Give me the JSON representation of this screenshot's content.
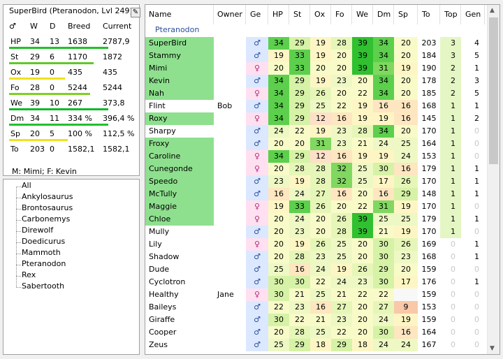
{
  "stats_panel": {
    "title": "SuperBird (Pteranodon, Lvl 249)",
    "edit_icon": "pencil-icon",
    "headers": [
      "W",
      "D",
      "Breed",
      "Current"
    ],
    "gender_symbol": "♂",
    "rows": [
      {
        "stat": "HP",
        "w": "34",
        "d": "13",
        "breed": "1638",
        "current": "2787,9",
        "bar_color": "#22c02a",
        "bar_fraction": 1.0
      },
      {
        "stat": "St",
        "w": "29",
        "d": "6",
        "breed": "1170",
        "current": "1872",
        "bar_color": "#60c828",
        "bar_fraction": 0.85
      },
      {
        "stat": "Ox",
        "w": "19",
        "d": "0",
        "breed": "435",
        "current": "435",
        "bar_color": "#f0e020",
        "bar_fraction": 0.56
      },
      {
        "stat": "Fo",
        "w": "28",
        "d": "0",
        "breed": "5244",
        "current": "5244",
        "bar_color": "#80d020",
        "bar_fraction": 0.82
      },
      {
        "stat": "We",
        "w": "39",
        "d": "10",
        "breed": "267",
        "current": "373,8",
        "bar_color": "#10b828",
        "bar_fraction": 1.0
      },
      {
        "stat": "Dm",
        "w": "34",
        "d": "11",
        "breed": "334 %",
        "current": "396,4 %",
        "bar_color": "#22c02a",
        "bar_fraction": 1.0
      },
      {
        "stat": "Sp",
        "w": "20",
        "d": "5",
        "breed": "100 %",
        "current": "112,5 %",
        "bar_color": "#f0e020",
        "bar_fraction": 0.59
      },
      {
        "stat": "To",
        "w": "203",
        "d": "0",
        "breed": "1582,1",
        "current": "1582,1",
        "bar_color": "",
        "bar_fraction": 0
      }
    ],
    "parents": "M: Mimi; F: Kevin"
  },
  "species_tree": [
    "All",
    "Ankylosaurus",
    "Brontosaurus",
    "Carbonemys",
    "Direwolf",
    "Doedicurus",
    "Mammoth",
    "Pteranodon",
    "Rex",
    "Sabertooth"
  ],
  "grid": {
    "columns": [
      "Name",
      "Owner",
      "Ge",
      "HP",
      "St",
      "Ox",
      "Fo",
      "We",
      "Dm",
      "Sp",
      "To",
      "Top",
      "Gen"
    ],
    "group_label": "Pteranodon",
    "rows": [
      {
        "name": "SuperBird",
        "owner": "",
        "g": "♂",
        "hp": "34",
        "st": "29",
        "ox": "19",
        "fo": "28",
        "we": "39",
        "dm": "34",
        "sp": "20",
        "to": "203",
        "top": "3",
        "gen": "4",
        "hl": true
      },
      {
        "name": "Stammy",
        "owner": "",
        "g": "♂",
        "hp": "19",
        "st": "33",
        "ox": "19",
        "fo": "20",
        "we": "39",
        "dm": "34",
        "sp": "20",
        "to": "184",
        "top": "3",
        "gen": "5",
        "hl": true
      },
      {
        "name": "Mimi",
        "owner": "",
        "g": "♀",
        "hp": "20",
        "st": "33",
        "ox": "20",
        "fo": "20",
        "we": "39",
        "dm": "31",
        "sp": "19",
        "to": "190",
        "top": "2",
        "gen": "1",
        "hl": true
      },
      {
        "name": "Kevin",
        "owner": "",
        "g": "♂",
        "hp": "34",
        "st": "29",
        "ox": "19",
        "fo": "23",
        "we": "20",
        "dm": "34",
        "sp": "20",
        "to": "178",
        "top": "2",
        "gen": "3",
        "hl": true
      },
      {
        "name": "Nah",
        "owner": "",
        "g": "♀",
        "hp": "34",
        "st": "29",
        "ox": "26",
        "fo": "20",
        "we": "22",
        "dm": "34",
        "sp": "20",
        "to": "185",
        "top": "2",
        "gen": "5",
        "hl": true
      },
      {
        "name": "Flint",
        "owner": "Bob",
        "g": "♂",
        "hp": "34",
        "st": "29",
        "ox": "25",
        "fo": "22",
        "we": "19",
        "dm": "16",
        "sp": "16",
        "to": "168",
        "top": "1",
        "gen": "1",
        "hl": false
      },
      {
        "name": "Roxy",
        "owner": "",
        "g": "♀",
        "hp": "34",
        "st": "29",
        "ox": "12",
        "fo": "16",
        "we": "19",
        "dm": "19",
        "sp": "16",
        "to": "145",
        "top": "1",
        "gen": "2",
        "hl": true
      },
      {
        "name": "Sharpy",
        "owner": "",
        "g": "♂",
        "hp": "24",
        "st": "22",
        "ox": "19",
        "fo": "23",
        "we": "28",
        "dm": "34",
        "sp": "20",
        "to": "170",
        "top": "1",
        "gen": "0",
        "hl": false
      },
      {
        "name": "Froxy",
        "owner": "",
        "g": "♂",
        "hp": "20",
        "st": "20",
        "ox": "31",
        "fo": "23",
        "we": "21",
        "dm": "24",
        "sp": "25",
        "to": "164",
        "top": "1",
        "gen": "0",
        "hl": true
      },
      {
        "name": "Caroline",
        "owner": "",
        "g": "♀",
        "hp": "34",
        "st": "29",
        "ox": "12",
        "fo": "16",
        "we": "19",
        "dm": "19",
        "sp": "24",
        "to": "153",
        "top": "1",
        "gen": "0",
        "hl": true
      },
      {
        "name": "Cunegonde",
        "owner": "",
        "g": "♀",
        "hp": "20",
        "st": "28",
        "ox": "28",
        "fo": "32",
        "we": "25",
        "dm": "30",
        "sp": "16",
        "to": "179",
        "top": "1",
        "gen": "1",
        "hl": true
      },
      {
        "name": "Speedo",
        "owner": "",
        "g": "♂",
        "hp": "23",
        "st": "19",
        "ox": "28",
        "fo": "32",
        "we": "25",
        "dm": "17",
        "sp": "26",
        "to": "170",
        "top": "1",
        "gen": "1",
        "hl": true
      },
      {
        "name": "McTully",
        "owner": "",
        "g": "♂",
        "hp": "16",
        "st": "24",
        "ox": "27",
        "fo": "16",
        "we": "20",
        "dm": "16",
        "sp": "29",
        "to": "148",
        "top": "1",
        "gen": "1",
        "hl": true
      },
      {
        "name": "Maggie",
        "owner": "",
        "g": "♀",
        "hp": "19",
        "st": "33",
        "ox": "26",
        "fo": "20",
        "we": "22",
        "dm": "31",
        "sp": "19",
        "to": "170",
        "top": "1",
        "gen": "0",
        "hl": true
      },
      {
        "name": "Chloe",
        "owner": "",
        "g": "♀",
        "hp": "20",
        "st": "24",
        "ox": "20",
        "fo": "26",
        "we": "39",
        "dm": "25",
        "sp": "25",
        "to": "179",
        "top": "1",
        "gen": "1",
        "hl": true
      },
      {
        "name": "Mully",
        "owner": "",
        "g": "♂",
        "hp": "20",
        "st": "23",
        "ox": "20",
        "fo": "28",
        "we": "39",
        "dm": "21",
        "sp": "19",
        "to": "170",
        "top": "1",
        "gen": "0",
        "hl": false
      },
      {
        "name": "Lily",
        "owner": "",
        "g": "♀",
        "hp": "20",
        "st": "19",
        "ox": "26",
        "fo": "25",
        "we": "20",
        "dm": "30",
        "sp": "26",
        "to": "169",
        "top": "0",
        "gen": "1",
        "hl": false
      },
      {
        "name": "Shadow",
        "owner": "",
        "g": "♂",
        "hp": "20",
        "st": "28",
        "ox": "23",
        "fo": "25",
        "we": "20",
        "dm": "30",
        "sp": "23",
        "to": "168",
        "top": "0",
        "gen": "1",
        "hl": false
      },
      {
        "name": "Dude",
        "owner": "",
        "g": "♂",
        "hp": "25",
        "st": "16",
        "ox": "24",
        "fo": "19",
        "we": "26",
        "dm": "29",
        "sp": "20",
        "to": "159",
        "top": "0",
        "gen": "0",
        "hl": false
      },
      {
        "name": "Cyclotron",
        "owner": "",
        "g": "♂",
        "hp": "30",
        "st": "30",
        "ox": "22",
        "fo": "24",
        "we": "23",
        "dm": "30",
        "sp": "17",
        "to": "176",
        "top": "0",
        "gen": "1",
        "hl": false
      },
      {
        "name": "Healthy",
        "owner": "Jane",
        "g": "♀",
        "hp": "30",
        "st": "21",
        "ox": "25",
        "fo": "21",
        "we": "22",
        "dm": "22",
        "sp": "",
        "to": "159",
        "top": "0",
        "gen": "0",
        "hl": false
      },
      {
        "name": "Baileys",
        "owner": "",
        "g": "♂",
        "hp": "22",
        "st": "23",
        "ox": "16",
        "fo": "27",
        "we": "20",
        "dm": "27",
        "sp": "9",
        "to": "153",
        "top": "0",
        "gen": "0",
        "hl": false
      },
      {
        "name": "Giraffe",
        "owner": "",
        "g": "♂",
        "hp": "30",
        "st": "22",
        "ox": "21",
        "fo": "23",
        "we": "20",
        "dm": "24",
        "sp": "19",
        "to": "159",
        "top": "0",
        "gen": "0",
        "hl": false
      },
      {
        "name": "Cooper",
        "owner": "",
        "g": "♂",
        "hp": "20",
        "st": "28",
        "ox": "25",
        "fo": "22",
        "we": "20",
        "dm": "30",
        "sp": "16",
        "to": "164",
        "top": "0",
        "gen": "0",
        "hl": false
      },
      {
        "name": "Zeus",
        "owner": "",
        "g": "♂",
        "hp": "25",
        "st": "29",
        "ox": "18",
        "fo": "29",
        "we": "18",
        "dm": "24",
        "sp": "24",
        "to": "167",
        "top": "0",
        "gen": "0",
        "hl": false
      }
    ]
  },
  "colors": {
    "highlight_name": "#8ee08e",
    "male_bg": "#dce8ff",
    "female_bg": "#ffe0f0"
  }
}
